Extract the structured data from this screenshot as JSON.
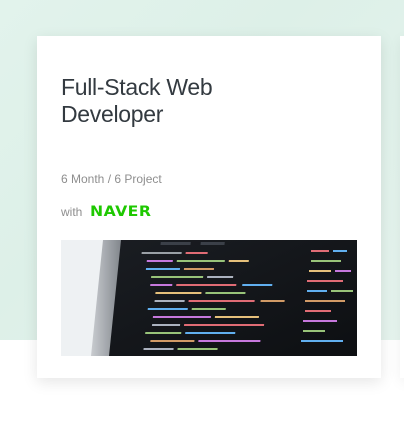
{
  "course": {
    "title_line1": "Full-Stack Web",
    "title_line2": "Developer",
    "meta": "6 Month / 6 Project",
    "with_label": "with",
    "partner_logo": "NAVER",
    "thumbnail": "code-editor-screenshot",
    "colors": {
      "background_tint": "#e2f3ec",
      "brand_green": "#1ec800"
    }
  }
}
